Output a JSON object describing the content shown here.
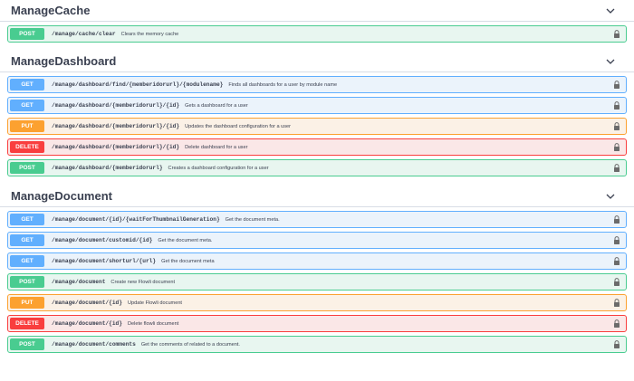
{
  "sections": [
    {
      "title": "ManageCache",
      "operations": [
        {
          "method": "POST",
          "path": "/manage/cache/clear",
          "summary": "Clears the memory cache"
        }
      ]
    },
    {
      "title": "ManageDashboard",
      "operations": [
        {
          "method": "GET",
          "path": "/manage/dashboard/find/{memberidorurl}/{modulename}",
          "summary": "Finds all dashboards for a user by module name"
        },
        {
          "method": "GET",
          "path": "/manage/dashboard/{memberidorurl}/{id}",
          "summary": "Gets a dashboard for a user"
        },
        {
          "method": "PUT",
          "path": "/manage/dashboard/{memberidorurl}/{id}",
          "summary": "Updates the dashboard configuration for a user"
        },
        {
          "method": "DELETE",
          "path": "/manage/dashboard/{memberidorurl}/{id}",
          "summary": "Delete dashboard for a user"
        },
        {
          "method": "POST",
          "path": "/manage/dashboard/{memberidorurl}",
          "summary": "Creates a dashboard configuration for a user"
        }
      ]
    },
    {
      "title": "ManageDocument",
      "operations": [
        {
          "method": "GET",
          "path": "/manage/document/{id}/{waitForThumbnailGeneration}",
          "summary": "Get the document meta."
        },
        {
          "method": "GET",
          "path": "/manage/document/customid/{id}",
          "summary": "Get the document meta."
        },
        {
          "method": "GET",
          "path": "/manage/document/shorturl/{url}",
          "summary": "Get the document meta"
        },
        {
          "method": "POST",
          "path": "/manage/document",
          "summary": "Create new Flowli document"
        },
        {
          "method": "PUT",
          "path": "/manage/document/{id}",
          "summary": "Update Flowli document"
        },
        {
          "method": "DELETE",
          "path": "/manage/document/{id}",
          "summary": "Delete flowli document"
        },
        {
          "method": "POST",
          "path": "/manage/document/comments",
          "summary": "Get the comments of related to a document."
        }
      ]
    }
  ],
  "icons": {
    "section_toggle": "chevron-down-icon",
    "operation_auth": "lock-icon"
  },
  "colors": {
    "get": "#61affe",
    "post": "#49cc90",
    "put": "#fca130",
    "delete": "#f93e3e"
  }
}
